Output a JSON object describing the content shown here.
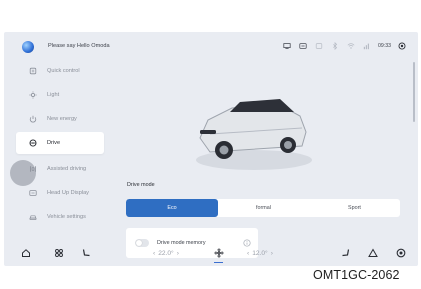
{
  "header": {
    "greeting": "Please say Hello Omoda",
    "time": "09:33"
  },
  "status_icons": [
    "cast-icon",
    "message-icon",
    "lte-icon",
    "bluetooth-icon",
    "wifi-icon",
    "signal-icon"
  ],
  "sidebar": {
    "items": [
      {
        "label": "Quick control",
        "icon": "quick-control-icon",
        "active": false
      },
      {
        "label": "Light",
        "icon": "light-icon",
        "active": false
      },
      {
        "label": "New energy",
        "icon": "energy-icon",
        "active": false
      },
      {
        "label": "Drive",
        "icon": "steering-wheel-icon",
        "active": true
      },
      {
        "label": "Assisted driving",
        "icon": "assist-icon",
        "active": false
      },
      {
        "label": "Head Up Display",
        "icon": "hud-icon",
        "active": false
      },
      {
        "label": "Vehicle settings",
        "icon": "car-icon",
        "active": false
      }
    ]
  },
  "main": {
    "section_label": "Drive mode",
    "modes": [
      {
        "label": "Eco",
        "selected": true
      },
      {
        "label": "formal",
        "selected": false
      },
      {
        "label": "Sport",
        "selected": false
      }
    ],
    "memory": {
      "label": "Drive mode memory",
      "enabled": false
    }
  },
  "dock": {
    "left_temp": "22.0°",
    "right_temp": "12.0°",
    "left_arrow": "‹",
    "right_arrow": "›"
  },
  "watermark": "OMT1GC-2062",
  "colors": {
    "accent": "#2f6ec2",
    "background": "#e9ecf2",
    "card": "#ffffff"
  }
}
